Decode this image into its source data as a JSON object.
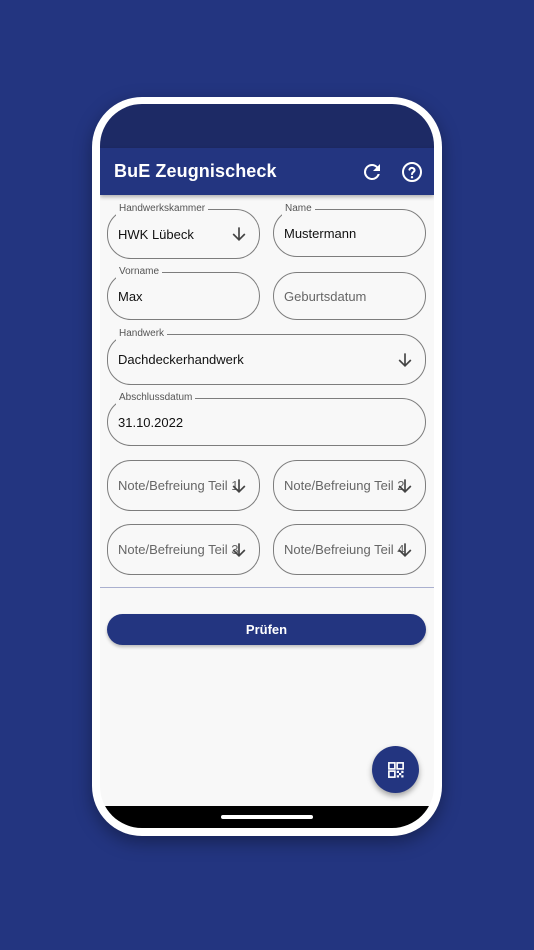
{
  "app": {
    "title": "BuE Zeugnischeck",
    "refresh_icon": "refresh-icon",
    "help_icon": "help-circle-icon"
  },
  "form": {
    "handwerkskammer": {
      "label": "Handwerkskammer",
      "value": "HWK Lübeck"
    },
    "name": {
      "label": "Name",
      "value": "Mustermann"
    },
    "vorname": {
      "label": "Vorname",
      "value": "Max"
    },
    "geburtsdatum": {
      "placeholder": "Geburtsdatum"
    },
    "handwerk": {
      "label": "Handwerk",
      "value": "Dachdeckerhandwerk"
    },
    "abschlussdatum": {
      "label": "Abschlussdatum",
      "value": "31.10.2022"
    },
    "note1": {
      "placeholder": "Note/Befreiung Teil 1"
    },
    "note2": {
      "placeholder": "Note/Befreiung Teil 2"
    },
    "note3": {
      "placeholder": "Note/Befreiung Teil 3"
    },
    "note4": {
      "placeholder": "Note/Befreiung Teil 4"
    }
  },
  "actions": {
    "submit_label": "Prüfen",
    "fab_icon": "qr-code-scan-icon"
  },
  "colors": {
    "brand": "#233580",
    "status_bar": "#1d2a65",
    "background": "#f8f8f8"
  }
}
